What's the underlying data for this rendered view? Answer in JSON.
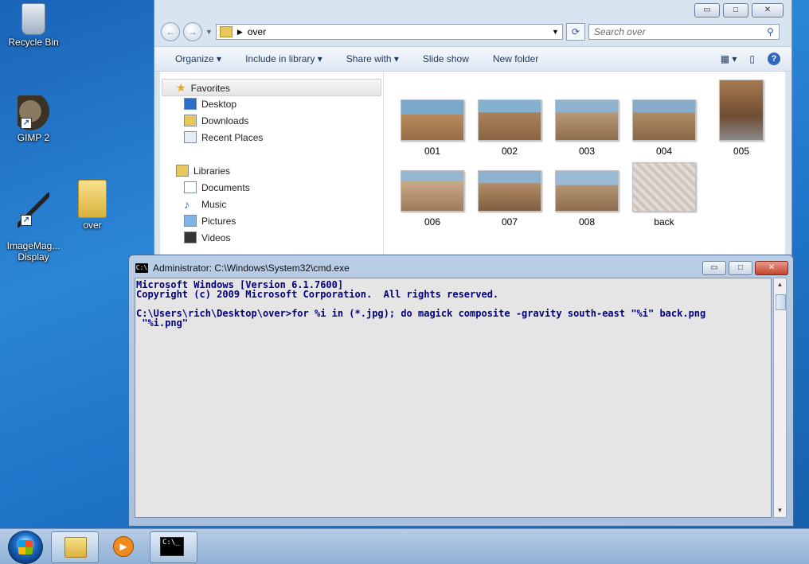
{
  "desktop": {
    "icons": [
      {
        "label": "Recycle Bin"
      },
      {
        "label": "GIMP 2"
      },
      {
        "label": "ImageMag...\nDisplay"
      },
      {
        "label": "over"
      }
    ]
  },
  "explorer": {
    "controls": {
      "minimize": "▭",
      "maximize": "□",
      "close": "✕"
    },
    "address": {
      "path": "over"
    },
    "search": {
      "placeholder": "Search over"
    },
    "toolbar": {
      "organize": "Organize",
      "include": "Include in library",
      "share": "Share with",
      "slideshow": "Slide show",
      "newfolder": "New folder"
    },
    "nav": {
      "favorites": "Favorites",
      "desktop": "Desktop",
      "downloads": "Downloads",
      "recent": "Recent Places",
      "libraries": "Libraries",
      "documents": "Documents",
      "music": "Music",
      "pictures": "Pictures",
      "videos": "Videos"
    },
    "files": [
      "001",
      "002",
      "003",
      "004",
      "005",
      "006",
      "007",
      "008",
      "back"
    ]
  },
  "cmd": {
    "title": "Administrator: C:\\Windows\\System32\\cmd.exe",
    "lines": {
      "l1": "Microsoft Windows [Version 6.1.7600]",
      "l2": "Copyright (c) 2009 Microsoft Corporation.  All rights reserved.",
      "l3": "C:\\Users\\rich\\Desktop\\over>for %i in (*.jpg); do magick composite -gravity south-east \"%i\" back.png",
      "l4": " \"%i.png\""
    }
  },
  "taskbar": {
    "cmd_icon": "C:\\_"
  }
}
